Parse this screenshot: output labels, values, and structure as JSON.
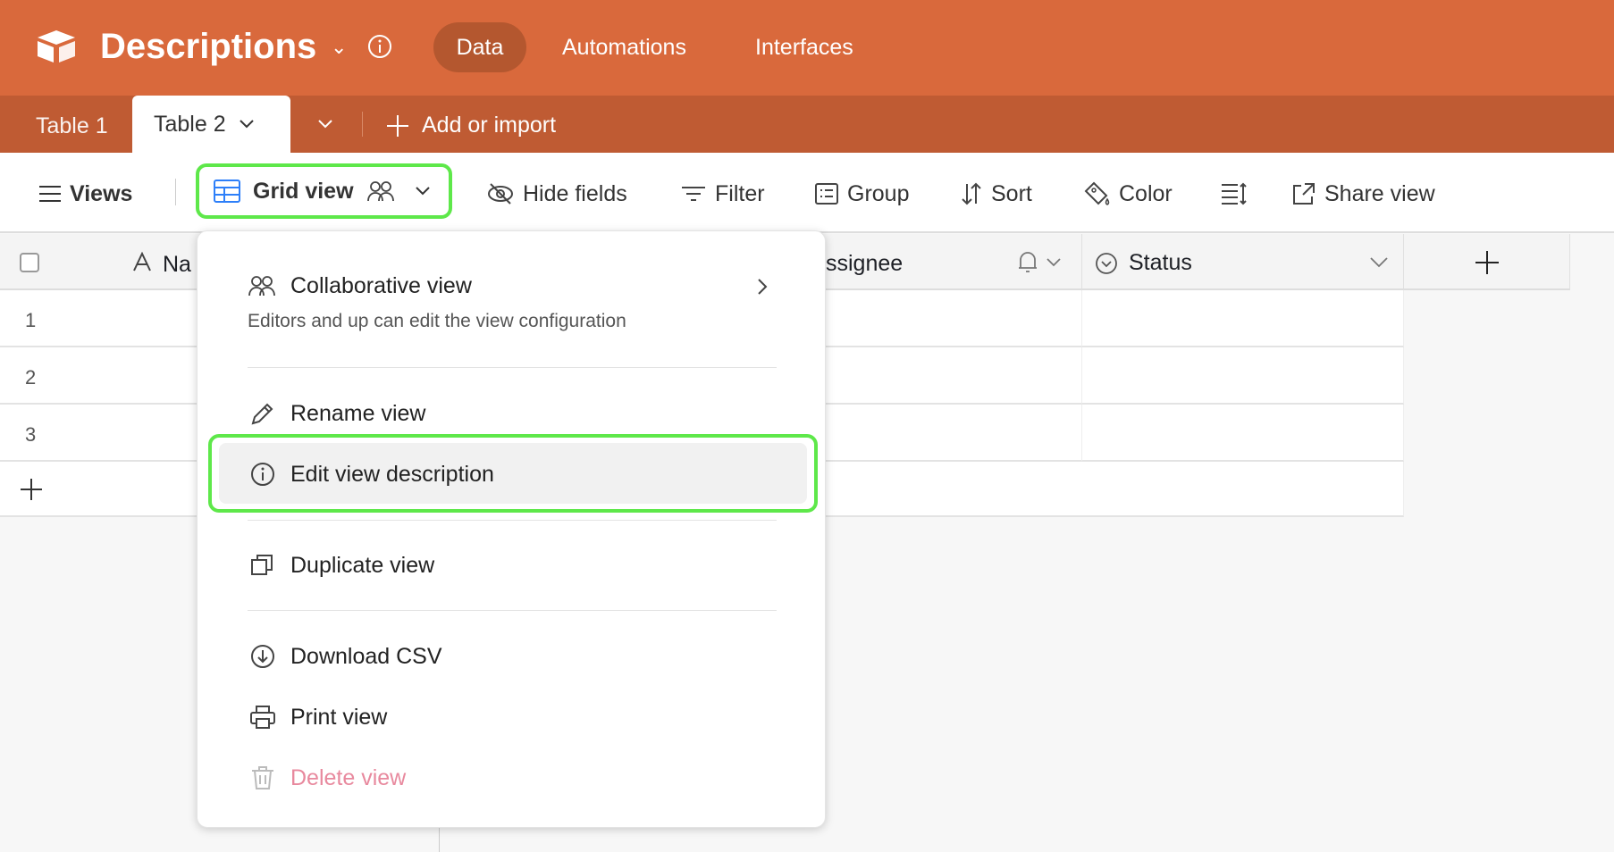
{
  "app": {
    "title": "Descriptions",
    "nav": [
      "Data",
      "Automations",
      "Interfaces"
    ]
  },
  "tabs": {
    "items": [
      "Table 1",
      "Table 2"
    ],
    "add_label": "Add or import"
  },
  "toolbar": {
    "views": "Views",
    "grid_view": "Grid view",
    "hide_fields": "Hide fields",
    "filter": "Filter",
    "group": "Group",
    "sort": "Sort",
    "color": "Color",
    "share_view": "Share view"
  },
  "grid": {
    "columns": [
      "Na",
      "ssignee",
      "Status"
    ],
    "rows": [
      "1",
      "2",
      "3"
    ]
  },
  "menu": {
    "collab_title": "Collaborative view",
    "collab_desc": "Editors and up can edit the view configuration",
    "items": [
      "Rename view",
      "Edit view description",
      "Duplicate view",
      "Download CSV",
      "Print view",
      "Delete view"
    ]
  },
  "colors": {
    "brand": "#d9693c",
    "tabbar": "#bf5b33",
    "highlight": "#5ee84a",
    "danger": "#e8899e",
    "grid_icon": "#2d7ff9"
  }
}
